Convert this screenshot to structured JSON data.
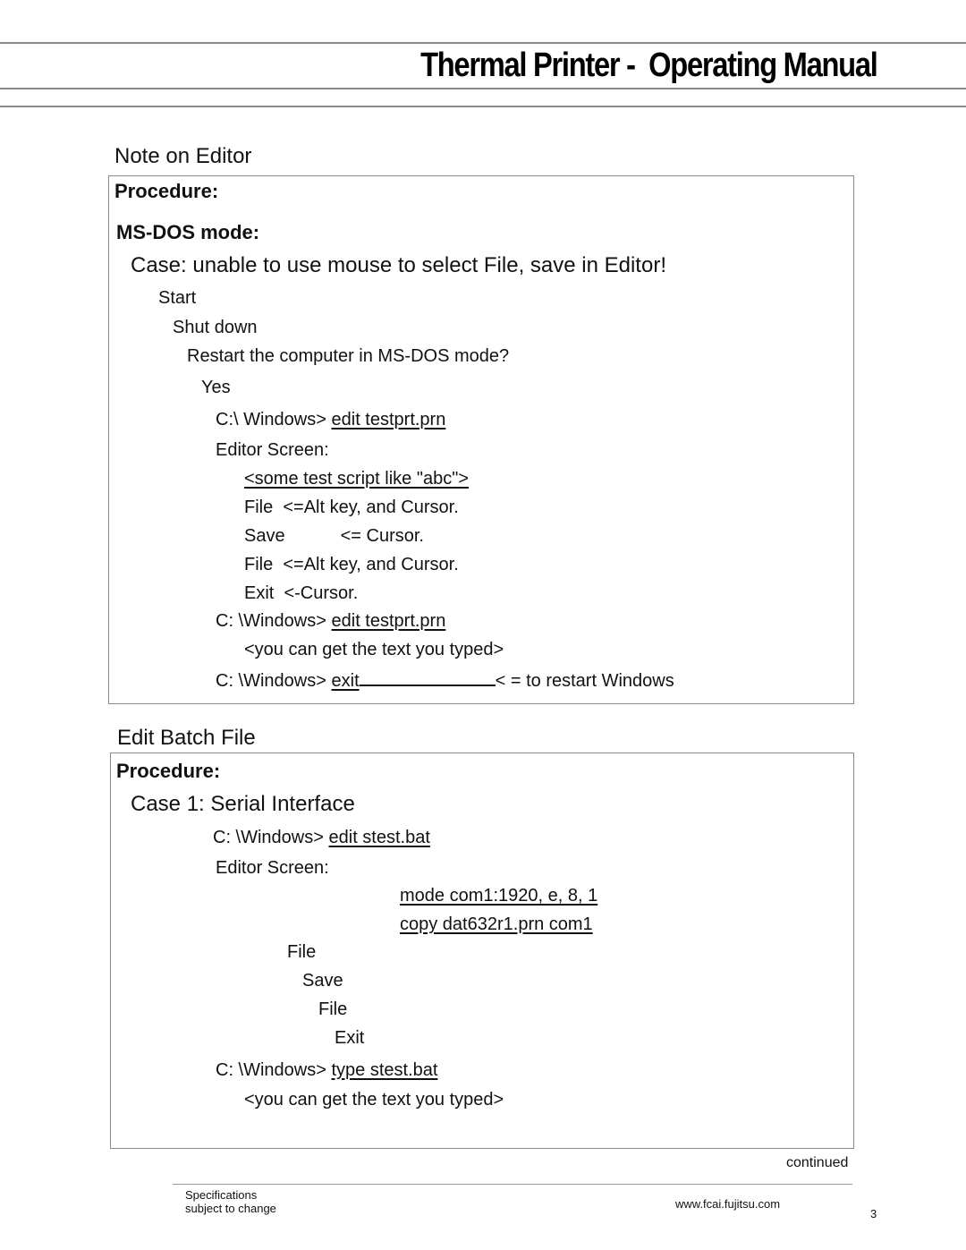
{
  "header": {
    "title_part1": "Thermal  Printer -",
    "title_part2": "Operating Manual"
  },
  "section1": {
    "heading": "Note on Editor",
    "procedure_label": "Procedure:",
    "mode_label": "MS-DOS mode:",
    "case_text": "Case: unable to use mouse to select File, save in Editor!",
    "steps": {
      "start": "Start",
      "shut_down": "Shut down",
      "restart_prompt": "Restart the computer in MS-DOS mode?",
      "yes": "Yes",
      "prompt1_prefix": "C:\\ Windows>",
      "prompt1_cmd": "edit testprt.prn",
      "editor_screen": "Editor Screen:",
      "script_text": "<some test script like \"abc\">",
      "file1_label": "File",
      "file1_note": "<=Alt key, and Cursor.",
      "save_label": "Save",
      "save_note": "<= Cursor.",
      "file2_label": "File",
      "file2_note": "<=Alt key, and Cursor.",
      "exit_label": "Exit",
      "exit_note": "<-Cursor.",
      "prompt2_prefix": "C: \\Windows>",
      "prompt2_cmd": "edit testprt.prn",
      "result_text": "<you can get the text you typed>",
      "prompt3_prefix": "C: \\Windows>",
      "prompt3_cmd": "exit",
      "prompt3_note": "< = to restart Windows"
    }
  },
  "section2": {
    "heading": "Edit Batch File",
    "procedure_label": "Procedure:",
    "case_text": "Case 1: Serial Interface",
    "steps": {
      "prompt1_prefix": "C: \\Windows>",
      "prompt1_cmd": "edit stest.bat",
      "editor_screen": "Editor Screen:",
      "line1": "mode com1:1920, e, 8, 1",
      "line2": "copy dat632r1.prn com1",
      "file1": "File",
      "save": "Save",
      "file2": "File",
      "exit": "Exit",
      "prompt2_prefix": "C: \\Windows>",
      "prompt2_cmd": "type stest.bat",
      "result_text": "<you can get the text you typed>"
    }
  },
  "continued": "continued",
  "footer": {
    "spec_line1": "Specifications",
    "spec_line2": "subject to change",
    "website": "www.fcai.fujitsu.com",
    "page_number": "3"
  }
}
